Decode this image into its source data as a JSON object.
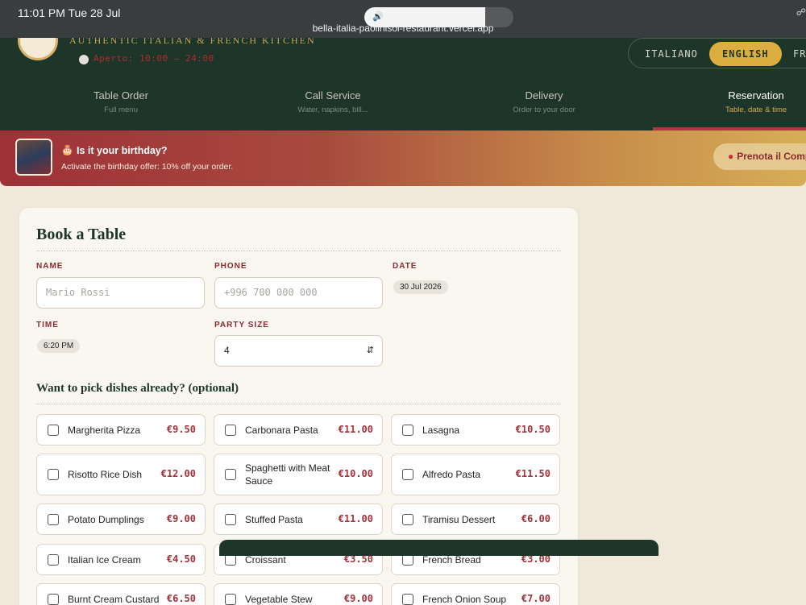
{
  "status_bar": {
    "time": "11:01 PM  Tue 28 Jul",
    "url": "bella-italia-paolinisoi-restaurant.vercel.app"
  },
  "header": {
    "brand_sub": "AUTHENTIC ITALIAN & FRENCH KITCHEN",
    "open_hours": "Aperto: 10:00 – 24:00",
    "languages": [
      "ITALIANO",
      "ENGLISH",
      "FR"
    ]
  },
  "tabs": [
    {
      "title": "Table Order",
      "sub": "Full menu"
    },
    {
      "title": "Call Service",
      "sub": "Water, napkins, bill..."
    },
    {
      "title": "Delivery",
      "sub": "Order to your door"
    },
    {
      "title": "Reservation",
      "sub": "Table, date & time"
    }
  ],
  "banner": {
    "title": "Is it your birthday?",
    "text": "Activate the birthday offer: 10% off your order.",
    "button": "Prenota il Compleanno"
  },
  "form": {
    "title": "Book a Table",
    "name_label": "NAME",
    "name_placeholder": "Mario Rossi",
    "phone_label": "PHONE",
    "phone_placeholder": "+996 700 000 000",
    "date_label": "DATE",
    "date_value": "30 Jul 2026",
    "time_label": "TIME",
    "time_value": "6:20 PM",
    "party_label": "PARTY SIZE",
    "party_value": "4",
    "dishes_title": "Want to pick dishes already? (optional)"
  },
  "dishes": [
    {
      "name": "Margherita Pizza",
      "price": "€9.50"
    },
    {
      "name": "Carbonara Pasta",
      "price": "€11.00"
    },
    {
      "name": "Lasagna",
      "price": "€10.50"
    },
    {
      "name": "Risotto Rice Dish",
      "price": "€12.00"
    },
    {
      "name": "Spaghetti with Meat Sauce",
      "price": "€10.00"
    },
    {
      "name": "Alfredo Pasta",
      "price": "€11.50"
    },
    {
      "name": "Potato Dumplings",
      "price": "€9.00"
    },
    {
      "name": "Stuffed Pasta",
      "price": "€11.00"
    },
    {
      "name": "Tiramisu Dessert",
      "price": "€6.00"
    },
    {
      "name": "Italian Ice Cream",
      "price": "€4.50"
    },
    {
      "name": "Croissant",
      "price": "€3.50"
    },
    {
      "name": "French Bread",
      "price": "€3.00"
    },
    {
      "name": "Burnt Cream Custard",
      "price": "€6.50"
    },
    {
      "name": "Vegetable Stew",
      "price": "€9.00"
    },
    {
      "name": "French Onion Soup",
      "price": "€7.00"
    }
  ],
  "colors": {
    "header": "#1e3629",
    "accent": "#dcae3f",
    "price": "#a3323a",
    "banner_start": "#9e3038",
    "banner_end": "#d6ae57"
  }
}
